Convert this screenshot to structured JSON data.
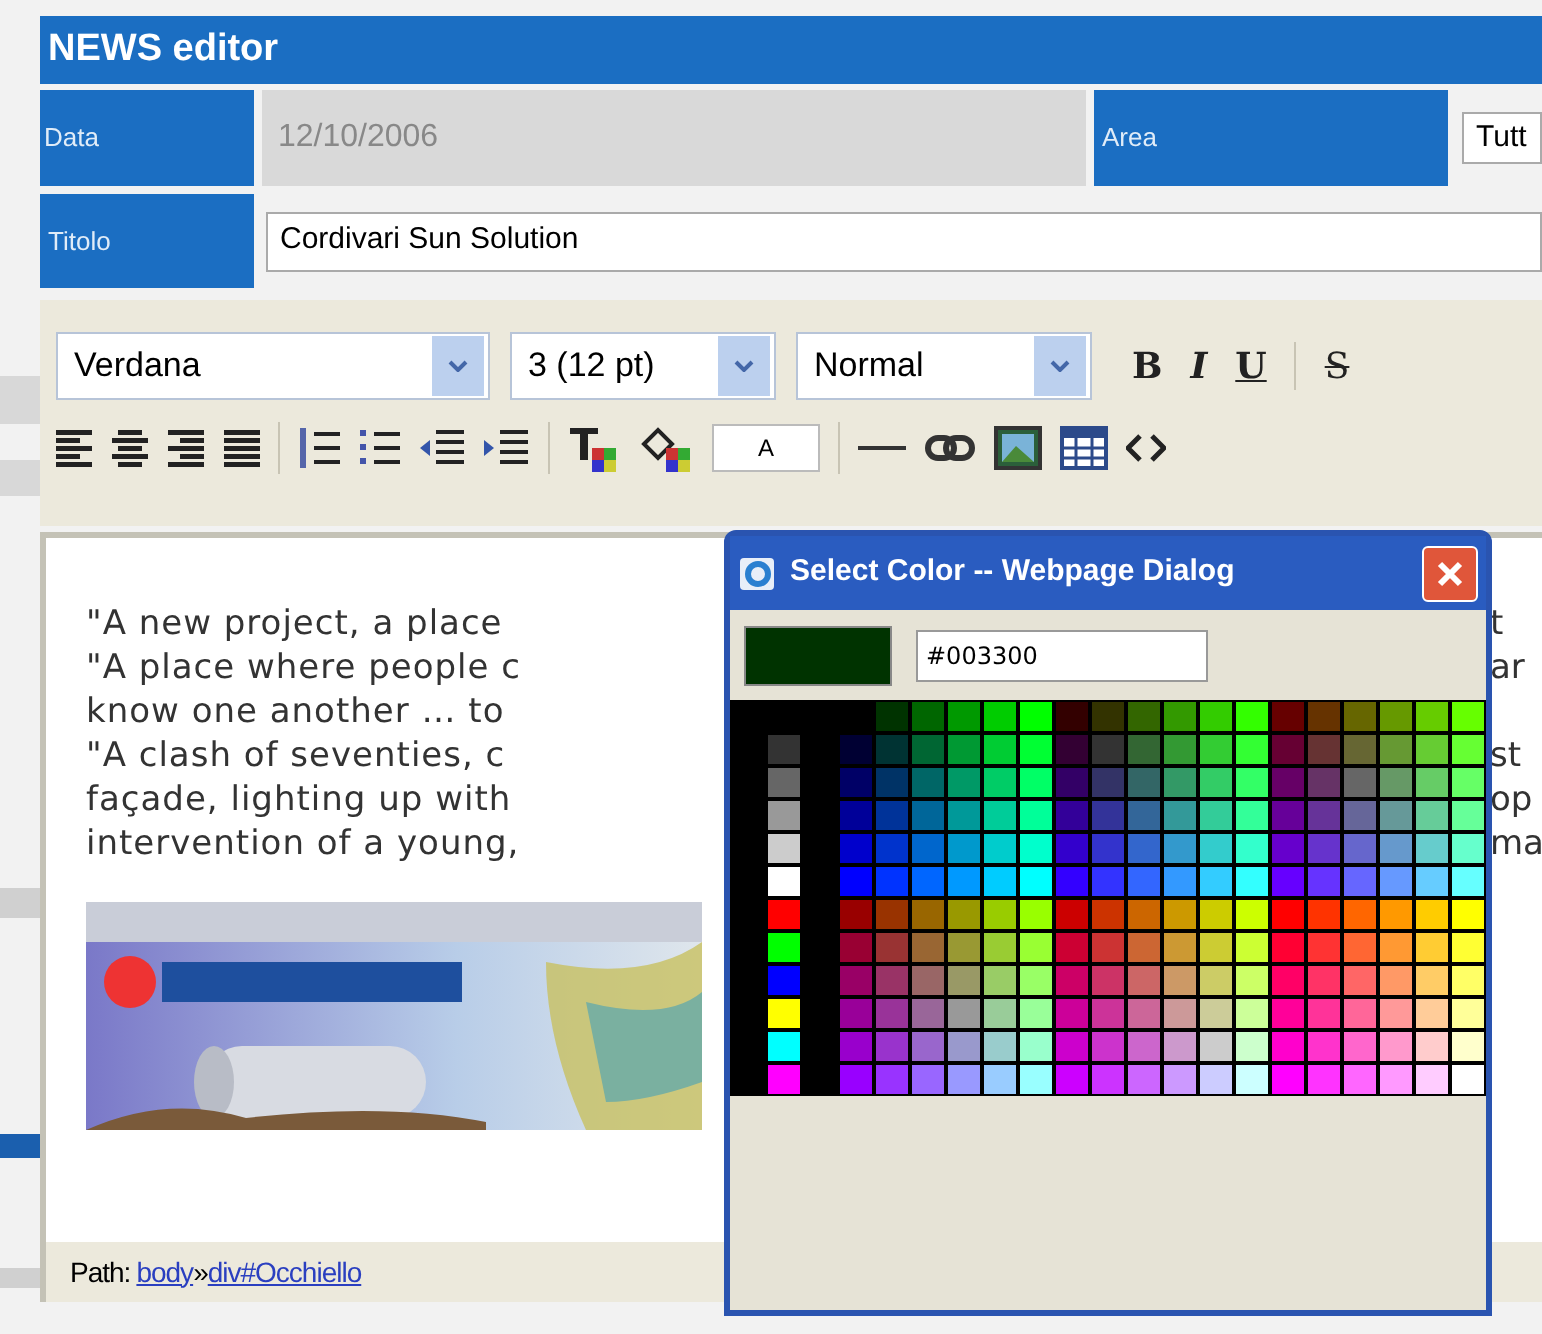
{
  "window": {
    "title": "NEWS editor"
  },
  "data_row": {
    "label": "Data",
    "value": "12/10/2006",
    "area_label": "Area",
    "area_value": "Tutt"
  },
  "title_row": {
    "label": "Titolo",
    "value": "Cordivari Sun Solution"
  },
  "toolbar": {
    "font": "Verdana",
    "size": "3 (12 pt)",
    "format": "Normal",
    "style_buttons": [
      "B",
      "I",
      "U",
      "S"
    ],
    "color_sample": "A"
  },
  "editor": {
    "lines": [
      {
        "left": "\"A new project, a place",
        "right": "t"
      },
      {
        "left": "\"A place where people c",
        "right": "ar"
      },
      {
        "left": "know one another … to"
      },
      {
        "left": "\"A clash of seventies, c",
        "right": "st"
      },
      {
        "left": "façade, lighting up with",
        "right": "op"
      },
      {
        "left": "intervention of a young,",
        "right": "ma"
      }
    ]
  },
  "path": {
    "label": "Path:",
    "segments": [
      "body",
      "div#Occhiello"
    ],
    "separator": "»"
  },
  "dialog": {
    "title": "Select Color -- Webpage Dialog",
    "hex_value": "#003300"
  }
}
